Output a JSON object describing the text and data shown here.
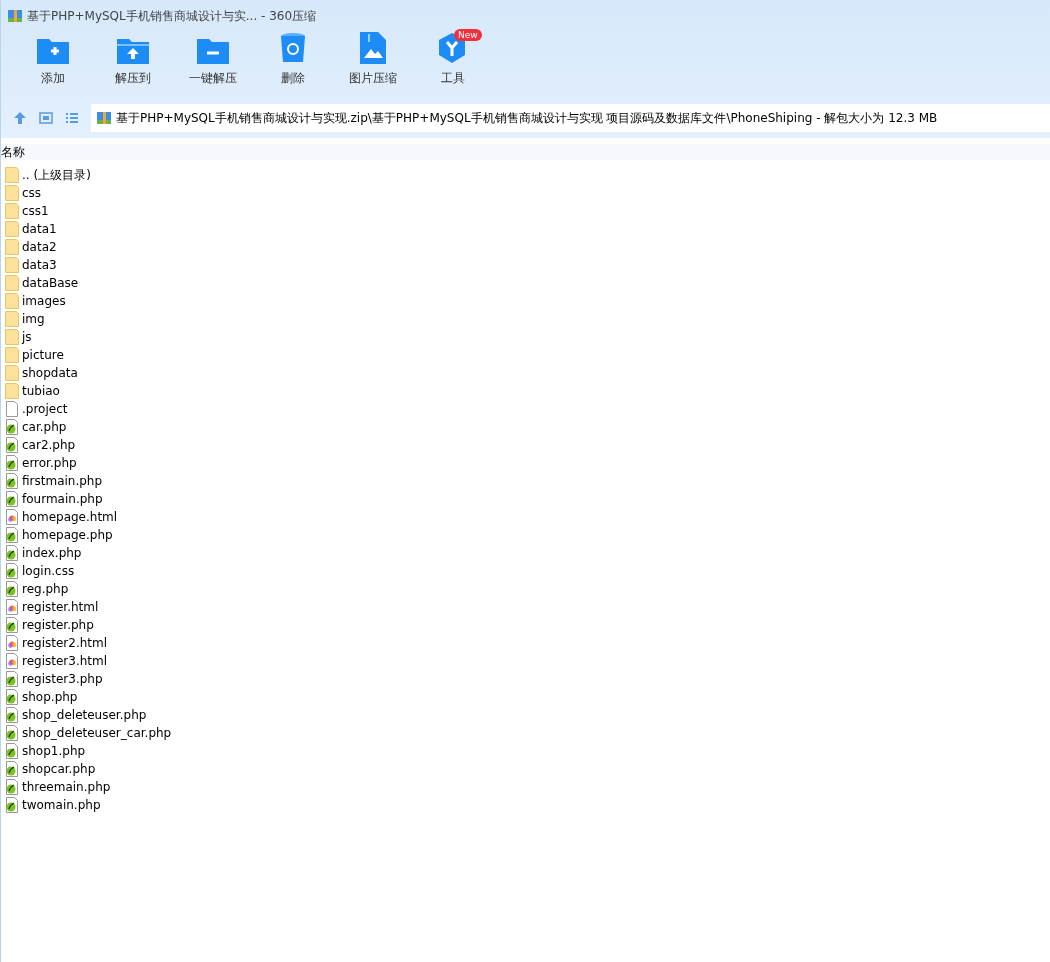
{
  "window": {
    "title": "基于PHP+MySQL手机销售商城设计与实... - 360压缩"
  },
  "toolbar": [
    {
      "label": "添加",
      "kind": "add"
    },
    {
      "label": "解压到",
      "kind": "extract"
    },
    {
      "label": "一键解压",
      "kind": "oneclick"
    },
    {
      "label": "删除",
      "kind": "delete"
    },
    {
      "label": "图片压缩",
      "kind": "image"
    },
    {
      "label": "工具",
      "kind": "tools",
      "badge": "New"
    }
  ],
  "address": {
    "path": "基于PHP+MySQL手机销售商城设计与实现.zip\\基于PHP+MySQL手机销售商城设计与实现 项目源码及数据库文件\\PhoneShiping - 解包大小为 12.3 MB"
  },
  "table": {
    "columns": [
      "名称"
    ],
    "rows": [
      {
        "name": ".. (上级目录)",
        "kind": "folder"
      },
      {
        "name": "css",
        "kind": "folder"
      },
      {
        "name": "css1",
        "kind": "folder"
      },
      {
        "name": "data1",
        "kind": "folder"
      },
      {
        "name": "data2",
        "kind": "folder"
      },
      {
        "name": "data3",
        "kind": "folder"
      },
      {
        "name": "dataBase",
        "kind": "folder"
      },
      {
        "name": "images",
        "kind": "folder"
      },
      {
        "name": "img",
        "kind": "folder"
      },
      {
        "name": "js",
        "kind": "folder"
      },
      {
        "name": "picture",
        "kind": "folder"
      },
      {
        "name": "shopdata",
        "kind": "folder"
      },
      {
        "name": "tubiao",
        "kind": "folder"
      },
      {
        "name": ".project",
        "kind": "file"
      },
      {
        "name": "car.php",
        "kind": "php"
      },
      {
        "name": "car2.php",
        "kind": "php"
      },
      {
        "name": "error.php",
        "kind": "php"
      },
      {
        "name": "firstmain.php",
        "kind": "php"
      },
      {
        "name": "fourmain.php",
        "kind": "php"
      },
      {
        "name": "homepage.html",
        "kind": "html"
      },
      {
        "name": "homepage.php",
        "kind": "php"
      },
      {
        "name": "index.php",
        "kind": "php"
      },
      {
        "name": "login.css",
        "kind": "php"
      },
      {
        "name": "reg.php",
        "kind": "php"
      },
      {
        "name": "register.html",
        "kind": "html"
      },
      {
        "name": "register.php",
        "kind": "php"
      },
      {
        "name": "register2.html",
        "kind": "html"
      },
      {
        "name": "register3.html",
        "kind": "html"
      },
      {
        "name": "register3.php",
        "kind": "php"
      },
      {
        "name": "shop.php",
        "kind": "php"
      },
      {
        "name": "shop_deleteuser.php",
        "kind": "php"
      },
      {
        "name": "shop_deleteuser_car.php",
        "kind": "php"
      },
      {
        "name": "shop1.php",
        "kind": "php"
      },
      {
        "name": "shopcar.php",
        "kind": "php"
      },
      {
        "name": "threemain.php",
        "kind": "php"
      },
      {
        "name": "twomain.php",
        "kind": "php"
      }
    ]
  }
}
